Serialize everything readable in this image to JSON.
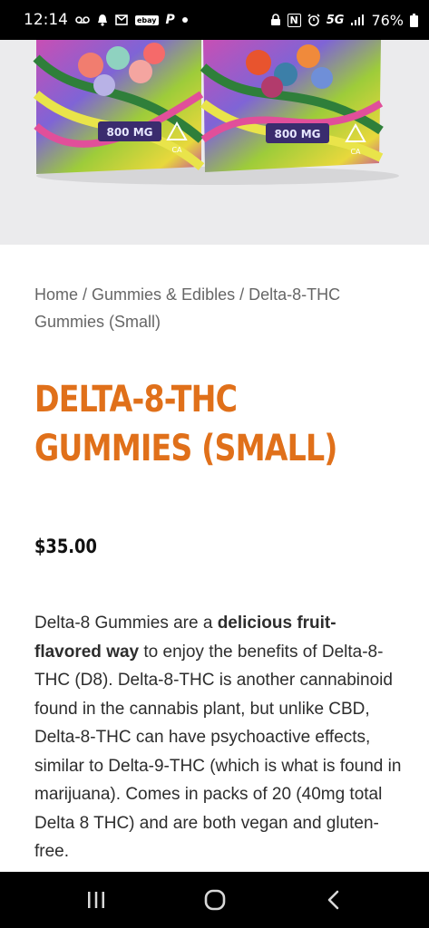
{
  "status_bar": {
    "time": "12:14",
    "left_icons": [
      "voicemail-icon",
      "bell-icon",
      "mail-icon",
      "ebay-icon",
      "paypal-icon",
      "dot-icon"
    ],
    "ebay_label": "ebay",
    "paypal_label": "P",
    "right_icons": [
      "lock-icon",
      "nfc-icon",
      "alarm-icon",
      "signal-icon",
      "battery-icon"
    ],
    "nfc_label": "N",
    "network": "5G",
    "battery": "76%"
  },
  "hero": {
    "left_package_label": "800 MG",
    "right_package_label": "800 MG",
    "stamp_label": "CA"
  },
  "breadcrumb": {
    "home": "Home",
    "sep1": " / ",
    "category": "Gummies & Edibles",
    "sep2": " / ",
    "current": "Delta-8-THC Gummies (Small)"
  },
  "product": {
    "title": "DELTA-8-THC GUMMIES (SMALL)",
    "price": "$35.00",
    "description": {
      "before": "Delta-8 Gummies are a ",
      "bold": "delicious fruit-flavored way",
      "after": " to enjoy the benefits of Delta-8-THC (D8). Delta-8-THC is another cannabinoid found in the cannabis plant, but unlike CBD, Delta-8-THC can have psychoactive effects, similar to Delta-9-THC (which is what is found in marijuana). Comes in packs of 20 (40mg total Delta 8 THC) and are both vegan and gluten-free."
    }
  },
  "nav_bar": {
    "buttons": [
      "recent-apps-icon",
      "home-icon",
      "back-icon"
    ]
  },
  "colors": {
    "title": "#e0701a",
    "text": "#2d2d2d",
    "breadcrumb": "#666666",
    "bars": "#000000"
  }
}
